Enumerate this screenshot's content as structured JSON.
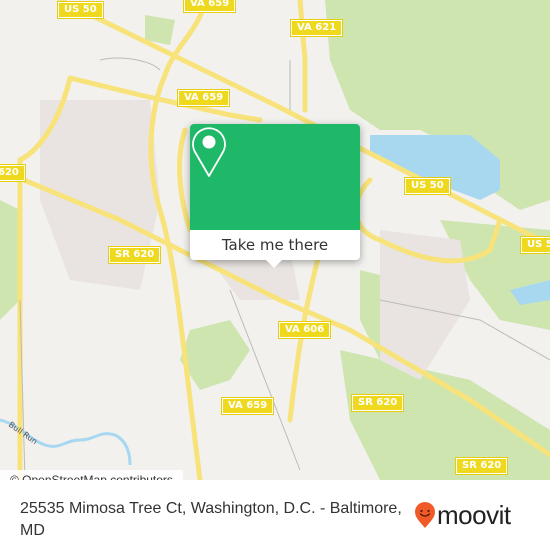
{
  "map": {
    "road_shields": [
      {
        "label": "US 50",
        "id": "us50-top-left"
      },
      {
        "label": "VA 659",
        "id": "va659-top"
      },
      {
        "label": "VA 621",
        "id": "va621"
      },
      {
        "label": "VA 659",
        "id": "va659-mid"
      },
      {
        "label": "620",
        "id": "sr620-left-edge"
      },
      {
        "label": "US 50",
        "id": "us50-right"
      },
      {
        "label": "US 5",
        "id": "us50-right-edge"
      },
      {
        "label": "SR 620",
        "id": "sr620-mid"
      },
      {
        "label": "VA 606",
        "id": "va606"
      },
      {
        "label": "SR 620",
        "id": "sr620-lower-right"
      },
      {
        "label": "VA 659",
        "id": "va659-bottom"
      },
      {
        "label": "SR 620",
        "id": "sr620-bottom-right"
      }
    ],
    "water_label": "Bull Run",
    "attribution": "© OpenStreetMap contributors",
    "colors": {
      "background": "#f2f1ee",
      "park": "#cfe5b0",
      "water": "#a8d8f0",
      "road": "#f7e37a",
      "residential": "#e9e4e1"
    }
  },
  "popup": {
    "icon": "map-pin-icon",
    "button_label": "Take me there",
    "accent_color": "#1fb868"
  },
  "footer": {
    "address": "25535 Mimosa Tree Ct, Washington, D.C. - Baltimore, MD",
    "brand": "moovit",
    "brand_color": "#f05a28"
  }
}
